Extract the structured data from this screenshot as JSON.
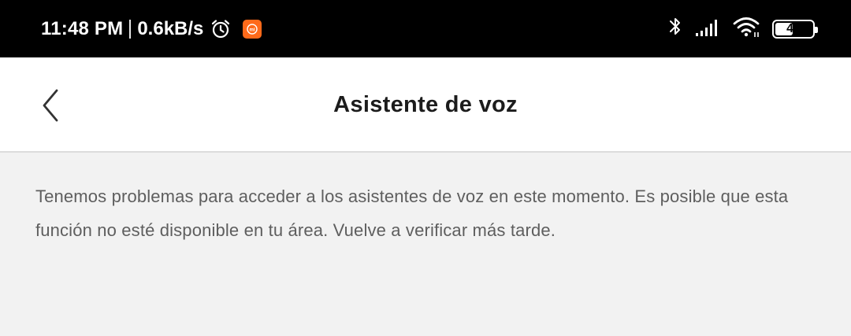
{
  "status_bar": {
    "time": "11:48 PM",
    "net_speed": "0.6kB/s",
    "battery_level": "49",
    "battery_fraction": 0.49,
    "icons": [
      "alarm-icon",
      "mi-app-icon",
      "bluetooth-icon",
      "signal-icon",
      "wifi-icon",
      "battery-icon"
    ]
  },
  "header": {
    "title": "Asistente de voz",
    "back_icon": "chevron-left-icon"
  },
  "main": {
    "message": "Tenemos problemas para acceder a los asistentes de voz en este momento. Es posible que esta función no esté disponible en tu área. Vuelve a verificar más tarde."
  },
  "colors": {
    "status_bar_bg": "#000000",
    "header_bg": "#ffffff",
    "content_bg": "#f2f2f2",
    "title_text": "#1c1c1c",
    "body_text": "#5e5e5e",
    "mi_brand": "#ff6a1a"
  }
}
